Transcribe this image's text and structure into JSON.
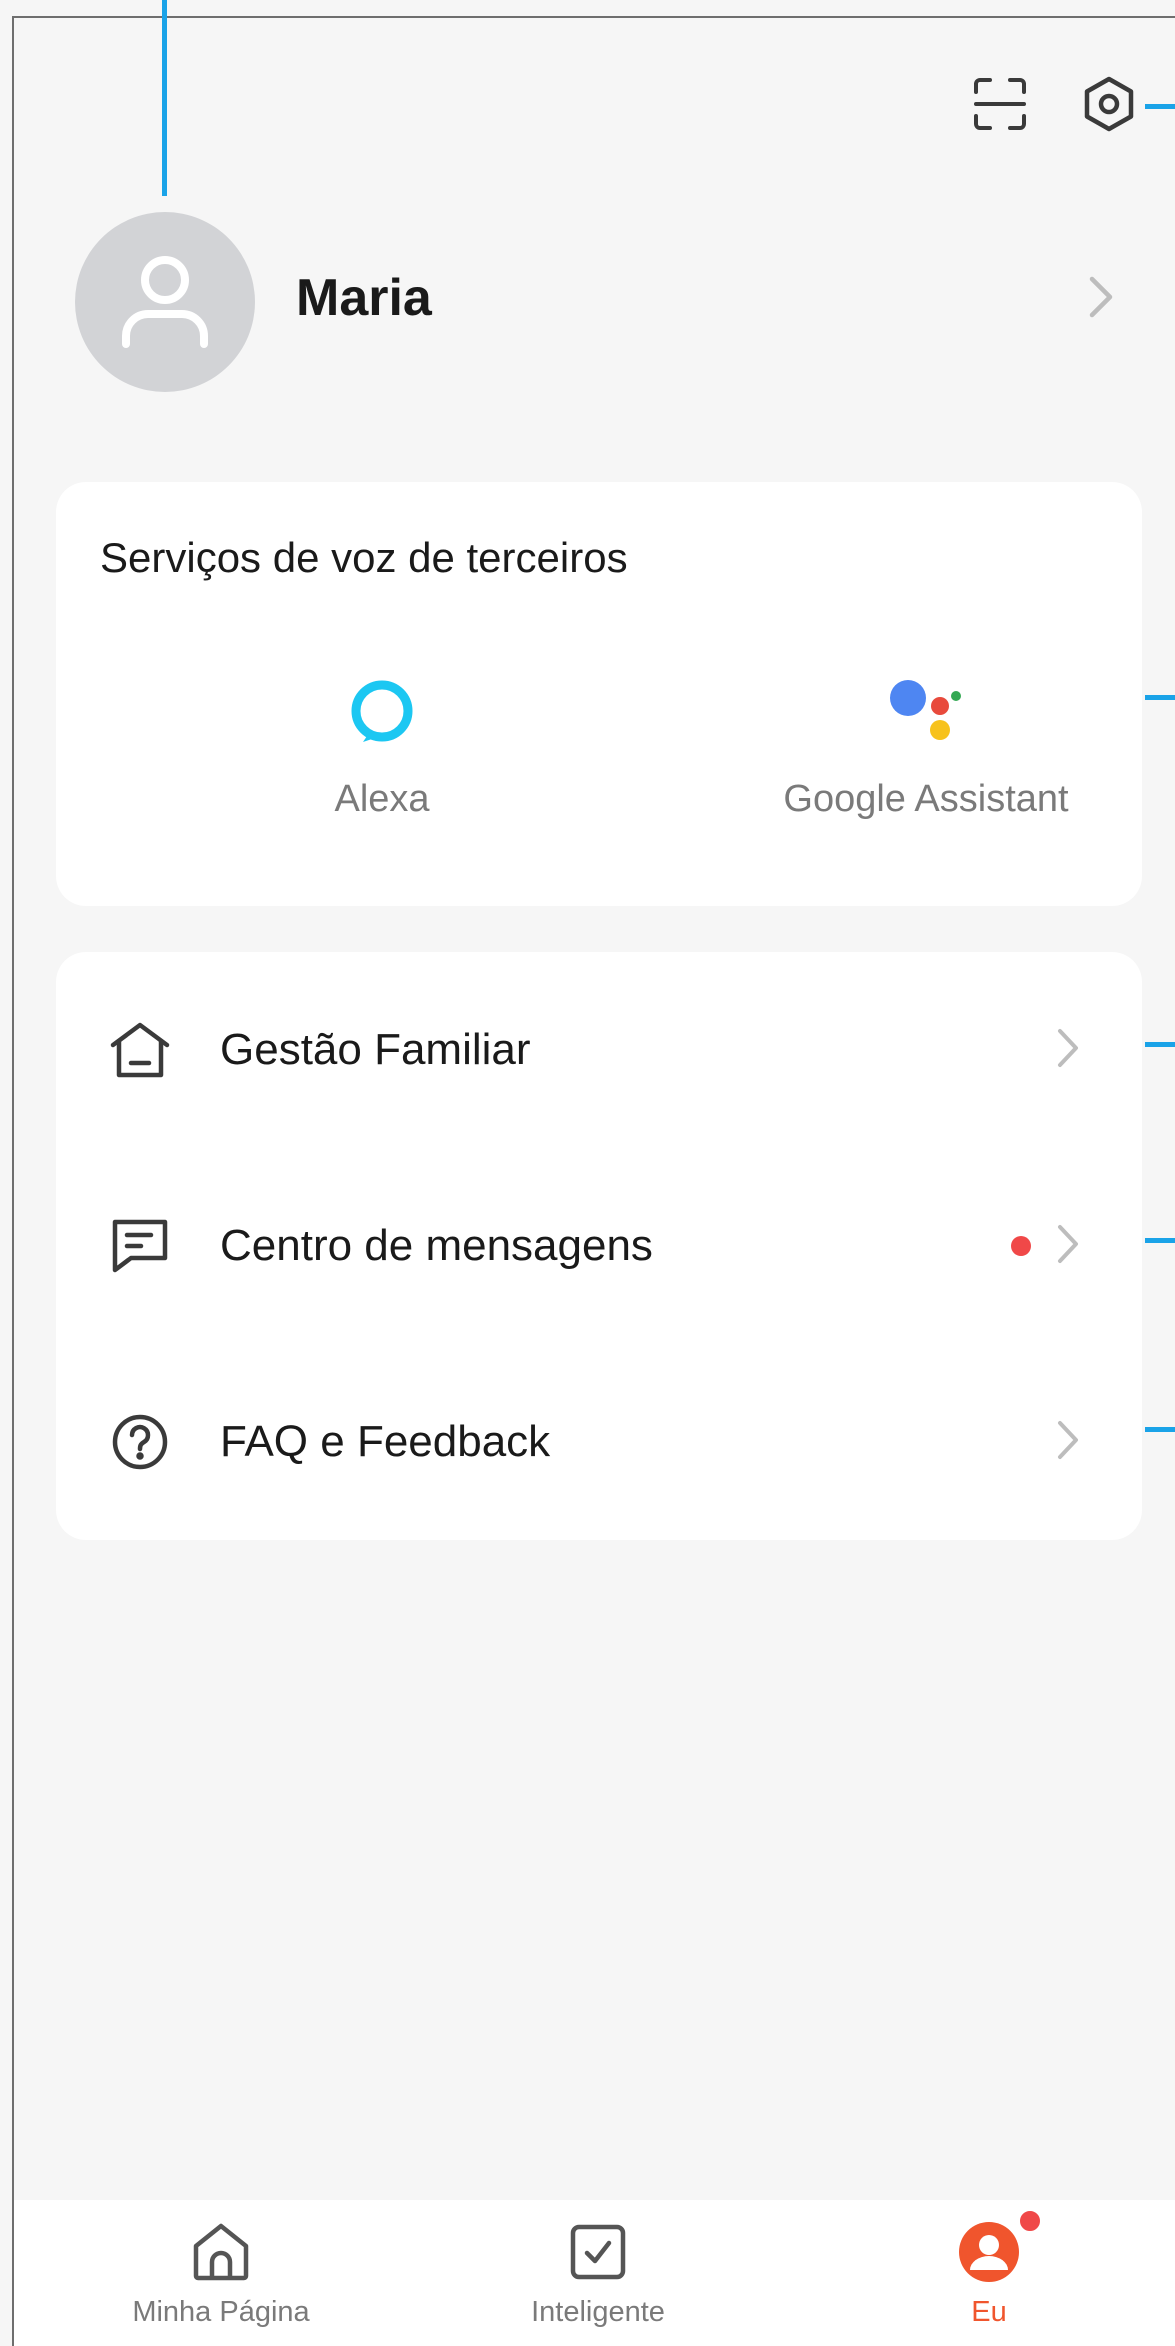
{
  "header": {
    "scan_icon": "scan-icon",
    "settings_icon": "hexagon-settings-icon"
  },
  "profile": {
    "name": "Maria",
    "avatar_icon": "user-placeholder-icon"
  },
  "voice_services": {
    "title": "Serviços de voz de terceiros",
    "items": [
      {
        "label": "Alexa",
        "icon": "alexa-icon"
      },
      {
        "label": "Google Assistant",
        "icon": "google-assistant-icon"
      }
    ]
  },
  "menu": {
    "items": [
      {
        "label": "Gestão Familiar",
        "icon": "home-icon",
        "has_badge": false
      },
      {
        "label": "Centro de mensagens",
        "icon": "message-icon",
        "has_badge": true
      },
      {
        "label": "FAQ e Feedback",
        "icon": "help-icon",
        "has_badge": false
      }
    ]
  },
  "bottom_nav": {
    "items": [
      {
        "label": "Minha Página",
        "icon": "home-icon",
        "active": false
      },
      {
        "label": "Inteligente",
        "icon": "checkbox-icon",
        "active": false
      },
      {
        "label": "Eu",
        "icon": "profile-icon",
        "active": true
      }
    ]
  },
  "colors": {
    "background": "#f6f6f6",
    "card": "#ffffff",
    "accent": "#f0552d",
    "badge": "#f04848",
    "callout": "#1aa3e8",
    "alexa": "#1cc7f2"
  }
}
